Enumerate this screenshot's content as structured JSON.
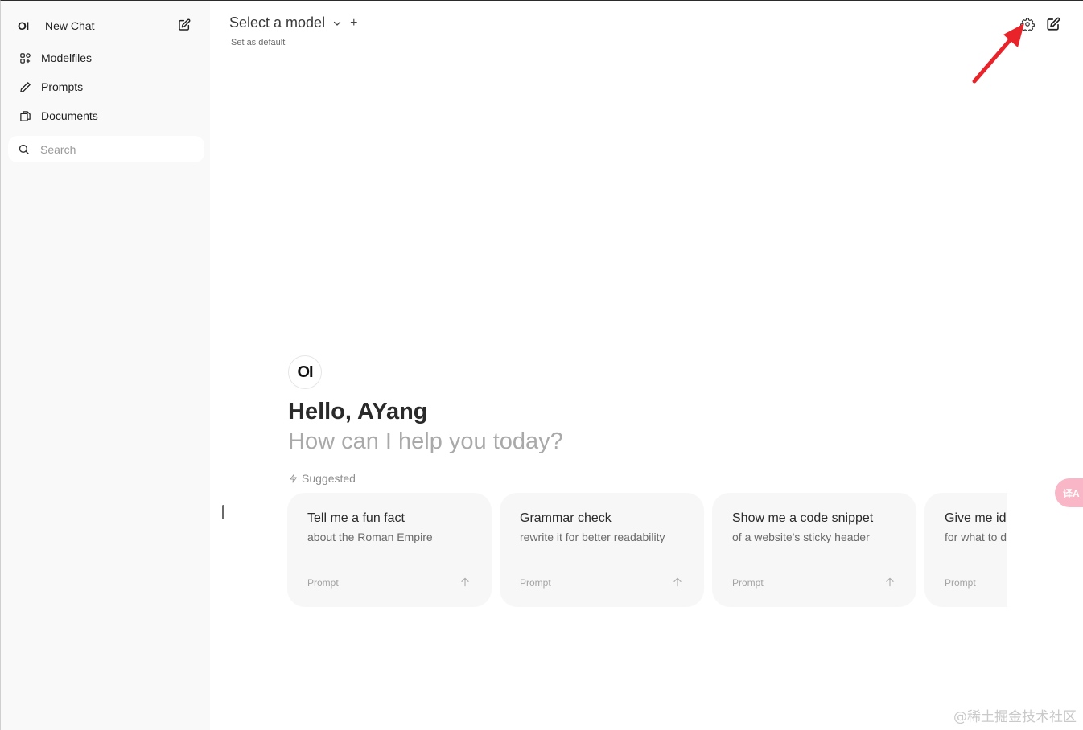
{
  "sidebar": {
    "logo": "OI",
    "new_chat": "New Chat",
    "items": [
      {
        "label": "Modelfiles",
        "icon": "modelfiles-icon"
      },
      {
        "label": "Prompts",
        "icon": "pencil-icon"
      },
      {
        "label": "Documents",
        "icon": "documents-icon"
      }
    ],
    "search": {
      "placeholder": "Search",
      "value": ""
    }
  },
  "header": {
    "model_select": "Select a model",
    "add": "+",
    "set_default": "Set as default",
    "icons": [
      "gear-icon",
      "edit-icon"
    ]
  },
  "welcome": {
    "logo": "OI",
    "greeting": "Hello, AYang",
    "subtitle": "How can I help you today?",
    "suggested_label": "Suggested"
  },
  "suggestions": [
    {
      "title": "Tell me a fun fact",
      "desc": "about the Roman Empire",
      "tag": "Prompt"
    },
    {
      "title": "Grammar check",
      "desc": "rewrite it for better readability",
      "tag": "Prompt"
    },
    {
      "title": "Show me a code snippet",
      "desc": "of a website's sticky header",
      "tag": "Prompt"
    },
    {
      "title": "Give me ideas",
      "desc": "for what to do",
      "tag": "Prompt"
    }
  ],
  "translate_button": "译A",
  "watermark": "@稀土掘金技术社区",
  "colors": {
    "sidebar_bg": "#f9f9f9",
    "card_bg": "#f7f7f7",
    "annotation_arrow": "#e8232a",
    "translate_bg": "#f8b6c6"
  }
}
